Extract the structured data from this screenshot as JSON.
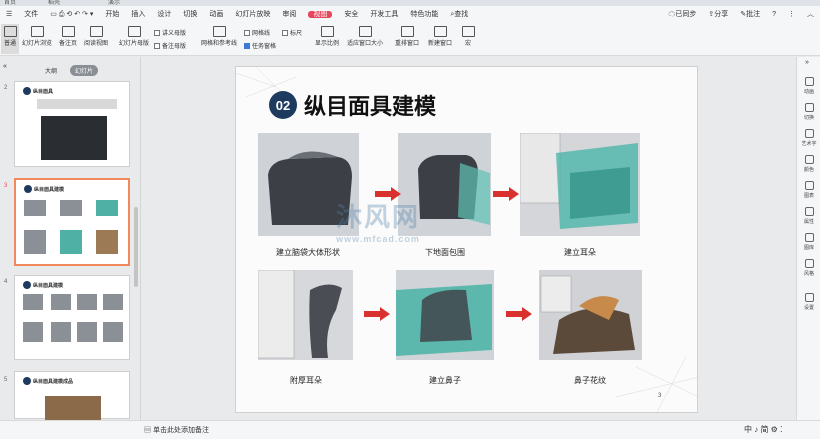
{
  "titlebar": {
    "tabs": [
      "首页",
      "稻壳",
      "演示"
    ]
  },
  "menu": {
    "file": "文件",
    "items": [
      "开始",
      "插入",
      "设计",
      "切换",
      "动画",
      "幻灯片放映",
      "审阅",
      "视图",
      "安全",
      "开发工具",
      "特色功能",
      "查找"
    ],
    "active": "视图",
    "sync": "已同步",
    "share": "分享",
    "comment": "批注"
  },
  "toolbar": {
    "buttons": [
      "普通",
      "幻灯片浏览",
      "备注页",
      "阅读视图",
      "幻灯片母版",
      "网格和参考线",
      "显示比例",
      "适应窗口大小",
      "重排窗口",
      "新建窗口",
      "宏"
    ],
    "checks": [
      {
        "label": "讲义母版",
        "on": false
      },
      {
        "label": "备注母版",
        "on": false
      },
      {
        "label": "网格线",
        "on": false
      },
      {
        "label": "标尺",
        "on": false
      },
      {
        "label": "任务窗格",
        "on": true
      }
    ]
  },
  "leftpane": {
    "tabs": [
      "大纲",
      "幻灯片"
    ],
    "selected_tab": "幻灯片",
    "thumbs": [
      {
        "num": "2",
        "title": "纵目面具"
      },
      {
        "num": "3",
        "title": "纵目面具建模"
      },
      {
        "num": "4",
        "title": "纵目面具建模"
      },
      {
        "num": "5",
        "title": "纵目面具建模成品"
      }
    ],
    "add": "+"
  },
  "slide": {
    "badge": "02",
    "title": "纵目面具建模",
    "captions": [
      "建立脑袋大体形状",
      "下地面包围",
      "建立耳朵",
      "附厚耳朵",
      "建立鼻子",
      "鼻子花纹"
    ],
    "watermark": "沐风网",
    "watermark_url": "www.mfcad.com",
    "page_num": "3"
  },
  "rightpane": [
    "动画",
    "切换",
    "艺术字",
    "颜色",
    "图表",
    "属性",
    "图库",
    "风格",
    "设置"
  ],
  "status": {
    "notes": "单击此处添加备注",
    "icons": "中 ♪ 简 ⚙ ⁚"
  },
  "colors": {
    "accent": "#e6465b",
    "badge": "#1e3a5f",
    "arrow": "#d9322e",
    "selection": "#f08a5d"
  }
}
